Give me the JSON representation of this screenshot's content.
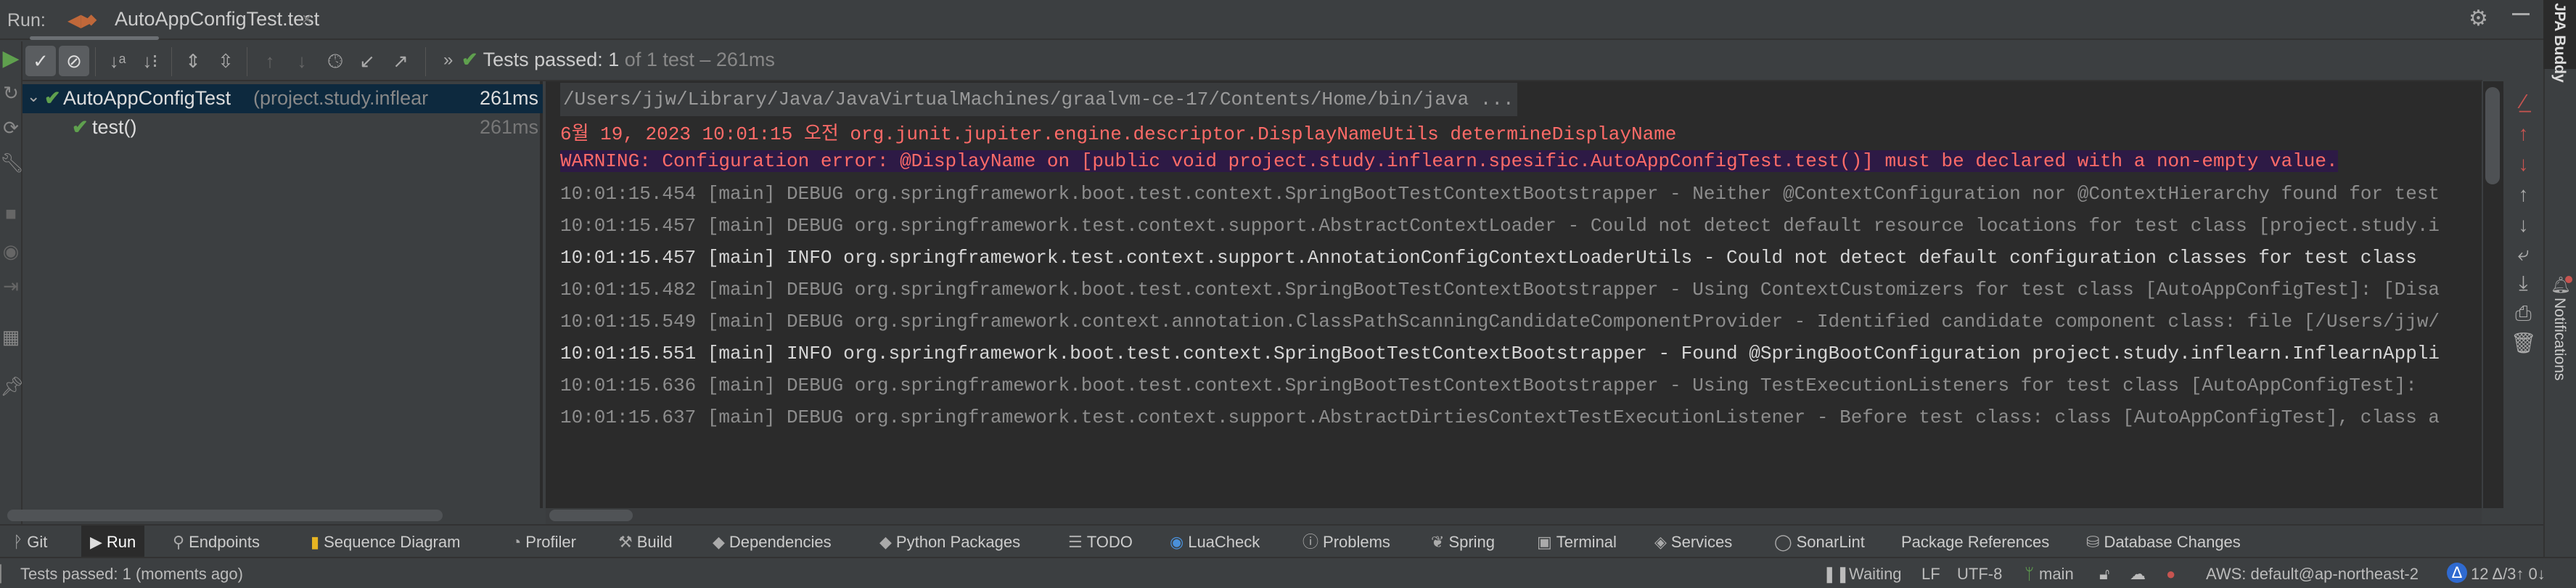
{
  "tabbar": {
    "run_label": "Run:",
    "tab_title": "AutoAppConfigTest.test",
    "close": "×"
  },
  "toolbar": {
    "status_prefix": "Tests passed:",
    "passed": "1",
    "status_suffix": "of 1 test – 261ms",
    "more": "»"
  },
  "tree": {
    "root": {
      "name": "AutoAppConfigTest",
      "package": "(project.study.inflear",
      "time": "261ms"
    },
    "child": {
      "name": "test()",
      "time": "261ms"
    }
  },
  "console": {
    "command": "/Users/jjw/Library/Java/JavaVirtualMachines/graalvm-ce-17/Contents/Home/bin/java ...",
    "lines": [
      {
        "level": "red",
        "text": "6월 19, 2023 10:01:15 오전 org.junit.jupiter.engine.descriptor.DisplayNameUtils determineDisplayName"
      },
      {
        "level": "warn",
        "text": "WARNING: Configuration error: @DisplayName on [public void project.study.inflearn.spesific.AutoAppConfigTest.test()] must be declared with a non-empty value."
      },
      {
        "level": "debug",
        "text": "10:01:15.454 [main] DEBUG org.springframework.boot.test.context.SpringBootTestContextBootstrapper - Neither @ContextConfiguration nor @ContextHierarchy found for test"
      },
      {
        "level": "debug",
        "text": "10:01:15.457 [main] DEBUG org.springframework.test.context.support.AbstractContextLoader - Could not detect default resource locations for test class [project.study.i"
      },
      {
        "level": "info",
        "text": "10:01:15.457 [main] INFO org.springframework.test.context.support.AnnotationConfigContextLoaderUtils - Could not detect default configuration classes for test class"
      },
      {
        "level": "debug",
        "text": "10:01:15.482 [main] DEBUG org.springframework.boot.test.context.SpringBootTestContextBootstrapper - Using ContextCustomizers for test class [AutoAppConfigTest]: [Disa"
      },
      {
        "level": "debug",
        "text": "10:01:15.549 [main] DEBUG org.springframework.context.annotation.ClassPathScanningCandidateComponentProvider - Identified candidate component class: file [/Users/jjw/"
      },
      {
        "level": "info",
        "text": "10:01:15.551 [main] INFO org.springframework.boot.test.context.SpringBootTestContextBootstrapper - Found @SpringBootConfiguration project.study.inflearn.InflearnAppli"
      },
      {
        "level": "debug",
        "text": "10:01:15.636 [main] DEBUG org.springframework.boot.test.context.SpringBootTestContextBootstrapper - Using TestExecutionListeners for test class [AutoAppConfigTest]:"
      },
      {
        "level": "debug",
        "text": "10:01:15.637 [main] DEBUG org.springframework.test.context.support.AbstractDirtiesContextTestExecutionListener - Before test class: class [AutoAppConfigTest], class a"
      }
    ]
  },
  "right_stripe": {
    "top": "JPA Buddy",
    "bottom": "Notifications"
  },
  "tool_windows": [
    {
      "label": "Git",
      "icon": "git-icon"
    },
    {
      "label": "Run",
      "icon": "run-icon"
    },
    {
      "label": "Endpoints",
      "icon": "endpoints-icon"
    },
    {
      "label": "Sequence Diagram",
      "icon": "sequence-diagram-icon"
    },
    {
      "label": "Profiler",
      "icon": "profiler-icon"
    },
    {
      "label": "Build",
      "icon": "build-icon"
    },
    {
      "label": "Dependencies",
      "icon": "dependencies-icon"
    },
    {
      "label": "Python Packages",
      "icon": "python-packages-icon"
    },
    {
      "label": "TODO",
      "icon": "todo-icon"
    },
    {
      "label": "LuaCheck",
      "icon": "luacheck-icon"
    },
    {
      "label": "Problems",
      "icon": "problems-icon"
    },
    {
      "label": "Spring",
      "icon": "spring-icon"
    },
    {
      "label": "Terminal",
      "icon": "terminal-icon"
    },
    {
      "label": "Services",
      "icon": "services-icon"
    },
    {
      "label": "SonarLint",
      "icon": "sonarlint-icon"
    },
    {
      "label": "Package References",
      "icon": ""
    },
    {
      "label": "Database Changes",
      "icon": "database-changes-icon"
    }
  ],
  "statusbar": {
    "message": "Tests passed: 1 (moments ago)",
    "waiting": "Waiting",
    "line_sep": "LF",
    "encoding": "UTF-8",
    "branch": "main",
    "aws": "AWS: default@ap-northeast-2",
    "vcs": "12 Δ/3↑ 0↓"
  },
  "colors": {
    "passed": "#5fa04e",
    "error": "#ff6b68",
    "selection": "#0d293e",
    "console_bg": "#2b2b2b"
  }
}
